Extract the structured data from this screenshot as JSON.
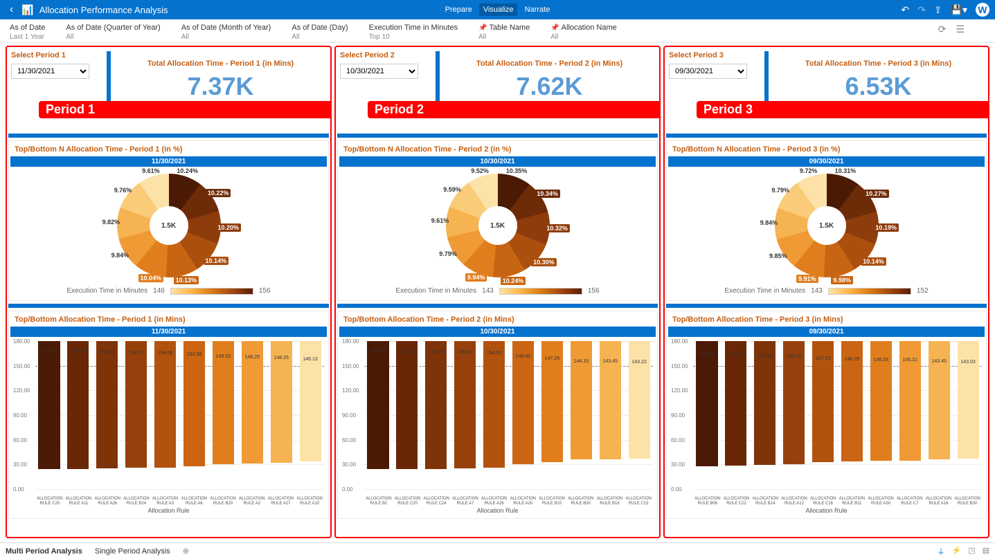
{
  "header": {
    "title": "Allocation Performance Analysis",
    "tabs": {
      "prepare": "Prepare",
      "visualize": "Visualize",
      "narrate": "Narrate"
    },
    "avatar": "W"
  },
  "filters": {
    "asOfDate": {
      "label": "As of Date",
      "value": "Last 1 Year"
    },
    "asOfDateQuarter": {
      "label": "As of Date (Quarter of Year)",
      "value": "All"
    },
    "asOfDateMonth": {
      "label": "As of Date (Month of Year)",
      "value": "All"
    },
    "asOfDateDay": {
      "label": "As of Date (Day)",
      "value": "All"
    },
    "execTime": {
      "label": "Execution Time in Minutes",
      "value": "Top 10"
    },
    "tableName": {
      "label": "Table Name",
      "value": "All",
      "pinned": true
    },
    "allocationName": {
      "label": "Allocation Name",
      "value": "All",
      "pinned": true
    }
  },
  "legend_label": "Execution Time in Minutes",
  "bar_y_title": "Execution Time in Minutes",
  "bar_x_title": "Allocation Rule",
  "periods": [
    {
      "badge": "Period 1",
      "select_title": "Select Period 1",
      "date": "11/30/2021",
      "kpi_title": "Total Allocation Time - Period 1 (in Mins)",
      "kpi_value": "7.37K",
      "donut_title": "Top/Bottom N Allocation Time - Period 1 (in %)",
      "donut_center": "1.5K",
      "legend_min": "146",
      "legend_max": "156",
      "bar_title": "Top/Bottom Allocation Time - Period 1 (in Mins)"
    },
    {
      "badge": "Period 2",
      "select_title": "Select Period 2",
      "date": "10/30/2021",
      "kpi_title": "Total Allocation Time - Period 2 (in Mins)",
      "kpi_value": "7.62K",
      "donut_title": "Top/Bottom N Allocation Time - Period 2 (in %)",
      "donut_center": "1.5K",
      "legend_min": "143",
      "legend_max": "156",
      "bar_title": "Top/Bottom Allocation Time - Period 2 (in Mins)"
    },
    {
      "badge": "Period 3",
      "select_title": "Select Period 3",
      "date": "09/30/2021",
      "kpi_title": "Total Allocation Time - Period 3 (in Mins)",
      "kpi_value": "6.53K",
      "donut_title": "Top/Bottom N Allocation Time - Period 3 (in %)",
      "donut_center": "1.5K",
      "legend_min": "143",
      "legend_max": "152",
      "bar_title": "Top/Bottom Allocation Time - Period 3 (in Mins)"
    }
  ],
  "chart_data": {
    "donuts": [
      {
        "type": "donut",
        "title": "11/30/2021",
        "segments": [
          {
            "label": "10.24%",
            "color": "#4a1a05"
          },
          {
            "label": "10.22%",
            "color": "#6e2b08"
          },
          {
            "label": "10.20%",
            "color": "#8e3c0b"
          },
          {
            "label": "10.14%",
            "color": "#aa4f0e"
          },
          {
            "label": "10.13%",
            "color": "#c86513"
          },
          {
            "label": "10.04%",
            "color": "#e07e1e"
          },
          {
            "label": "9.84%",
            "color": "#ef9a35"
          },
          {
            "label": "9.82%",
            "color": "#f6b352"
          },
          {
            "label": "9.76%",
            "color": "#facb79"
          },
          {
            "label": "9.61%",
            "color": "#fde2a8"
          }
        ]
      },
      {
        "type": "donut",
        "title": "10/30/2021",
        "segments": [
          {
            "label": "10.35%",
            "color": "#4a1a05"
          },
          {
            "label": "10.34%",
            "color": "#6e2b08"
          },
          {
            "label": "10.32%",
            "color": "#8e3c0b"
          },
          {
            "label": "10.30%",
            "color": "#aa4f0e"
          },
          {
            "label": "10.24%",
            "color": "#c86513"
          },
          {
            "label": "9.94%",
            "color": "#e07e1e"
          },
          {
            "label": "9.79%",
            "color": "#ef9a35"
          },
          {
            "label": "9.61%",
            "color": "#f6b352"
          },
          {
            "label": "9.59%",
            "color": "#facb79"
          },
          {
            "label": "9.52%",
            "color": "#fde2a8"
          }
        ]
      },
      {
        "type": "donut",
        "title": "09/30/2021",
        "segments": [
          {
            "label": "10.31%",
            "color": "#4a1a05"
          },
          {
            "label": "10.27%",
            "color": "#6e2b08"
          },
          {
            "label": "10.19%",
            "color": "#8e3c0b"
          },
          {
            "label": "10.14%",
            "color": "#aa4f0e"
          },
          {
            "label": "9.98%",
            "color": "#c86513"
          },
          {
            "label": "9.91%",
            "color": "#e07e1e"
          },
          {
            "label": "9.85%",
            "color": "#ef9a35"
          },
          {
            "label": "9.84%",
            "color": "#f6b352"
          },
          {
            "label": "9.79%",
            "color": "#facb79"
          },
          {
            "label": "9.72%",
            "color": "#fde2a8"
          }
        ]
      }
    ],
    "bars": [
      {
        "type": "bar",
        "title": "11/30/2021",
        "ylim": [
          0,
          180
        ],
        "ylabel": "Execution Time in Minutes",
        "xlabel": "Allocation Rule",
        "categories": [
          "ALLOCATION RULE C20",
          "ALLOCATION RULE A11",
          "ALLOCATION RULE A26",
          "ALLOCATION RULE B24",
          "ALLOCATION RULE A3",
          "ALLOCATION RULE A6",
          "ALLOCATION RULE B20",
          "ALLOCATION RULE A2",
          "ALLOCATION RULE A27",
          "ALLOCATION RULE A10"
        ],
        "values": [
          155.63,
          155.38,
          155.13,
          154.17,
          154.08,
          152.58,
          149.55,
          149.25,
          148.25,
          146.13
        ],
        "colors": [
          "#4a1a05",
          "#6a2706",
          "#7f3309",
          "#96410b",
          "#b2520f",
          "#cb6513",
          "#e07e1e",
          "#ef9a35",
          "#f6b352",
          "#fde2a8"
        ]
      },
      {
        "type": "bar",
        "title": "10/30/2021",
        "ylim": [
          0,
          180
        ],
        "ylabel": "Execution Time in Minutes",
        "xlabel": "Allocation Rule",
        "categories": [
          "ALLOCATION RULE B1",
          "ALLOCATION RULE C20",
          "ALLOCATION RULE C24",
          "ALLOCATION RULE A7",
          "ALLOCATION RULE A26",
          "ALLOCATION RULE A20",
          "ALLOCATION RULE B10",
          "ALLOCATION RULE B30",
          "ALLOCATION RULE B18",
          "ALLOCATION RULE C13"
        ],
        "values": [
          155.63,
          155.55,
          155.2,
          155.0,
          154.03,
          149.45,
          147.28,
          144.15,
          143.45,
          143.22
        ],
        "colors": [
          "#4a1a05",
          "#6a2706",
          "#7f3309",
          "#96410b",
          "#b2520f",
          "#cb6513",
          "#e07e1e",
          "#ef9a35",
          "#f6b352",
          "#fde2a8"
        ]
      },
      {
        "type": "bar",
        "title": "09/30/2021",
        "ylim": [
          0,
          180
        ],
        "ylabel": "Execution Time in Minutes",
        "xlabel": "Allocation Rule",
        "categories": [
          "ALLOCATION RULE B06",
          "ALLOCATION RULE C22",
          "ALLOCATION RULE B14",
          "ALLOCATION RULE A12",
          "ALLOCATION RULE C16",
          "ALLOCATION RULE B11",
          "ALLOCATION RULE A30",
          "ALLOCATION RULE C7",
          "ALLOCATION RULE A16",
          "ALLOCATION RULE B30"
        ],
        "values": [
          152.23,
          151.63,
          150.43,
          149.62,
          147.23,
          146.25,
          145.33,
          145.21,
          143.45,
          143.03
        ],
        "colors": [
          "#4a1a05",
          "#6a2706",
          "#7f3309",
          "#96410b",
          "#b2520f",
          "#cb6513",
          "#e07e1e",
          "#ef9a35",
          "#f6b352",
          "#fde2a8"
        ]
      }
    ]
  },
  "bottom_tabs": {
    "multi": "Multi Period Analysis",
    "single": "Single Period Analysis"
  }
}
